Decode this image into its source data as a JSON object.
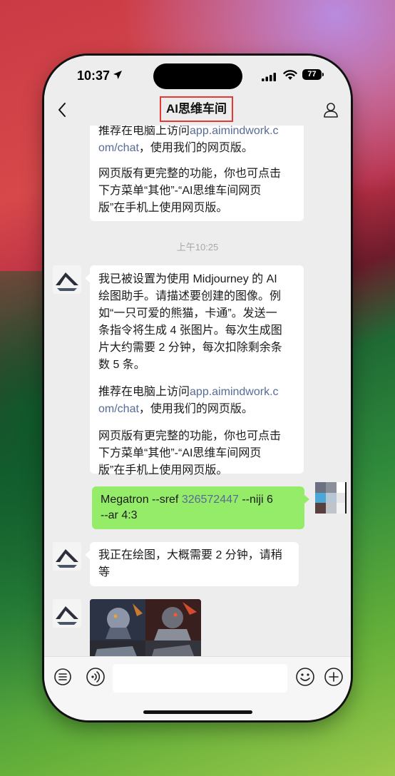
{
  "status_bar": {
    "time": "10:37",
    "battery": "77"
  },
  "nav": {
    "title": "AI思维车间"
  },
  "messages": {
    "first_partial": {
      "line1_pre": "推荐在电脑上访问",
      "line1_link": "app.aimindwork.c",
      "line2_link": "om/chat",
      "line2_post": "，使用我们的网页版。",
      "para2_line1": "网页版有更完整的功能，你也可点击",
      "para2_line2": "下方菜单“其他”-“AI思维车间网页",
      "para2_line3": "版”在手机上使用网页版。"
    },
    "timestamp": "上午10:25",
    "bot_intro": {
      "l1": "我已被设置为使用 Midjourney 的 AI",
      "l2": "绘图助手。请描述要创建的图像。例",
      "l3": "如“一只可爱的熊猫，卡通”。发送一",
      "l4": "条指令将生成 4 张图片。每次生成图",
      "l5": "片大约需要 2 分钟，每次扣除剩余条",
      "l6": "数 5 条。",
      "p2_pre": "推荐在电脑上访问",
      "p2_link1": "app.aimindwork.c",
      "p2_link2": "om/chat",
      "p2_post": "，使用我们的网页版。",
      "p3_l1": "网页版有更完整的功能，你也可点击",
      "p3_l2": "下方菜单“其他”-“AI思维车间网页",
      "p3_l3": "版”在手机上使用网页版。"
    },
    "user_msg": {
      "pre": "Megatron --sref ",
      "num": "326572447",
      "post": " --niji 6",
      "line2": "--ar 4:3"
    },
    "bot_reply": {
      "l1": "我正在绘图，大概需要 2 分钟，请稍",
      "l2": "等"
    }
  },
  "icons": {
    "back": "chevron-left-icon",
    "profile": "person-icon",
    "menu": "list-icon",
    "voice": "voice-icon",
    "emoji": "emoji-icon",
    "plus": "plus-circle-icon"
  },
  "colors": {
    "user_bubble": "#95ec69",
    "link": "#576b95",
    "chat_bg": "#ededed",
    "highlight_box": "#e53935"
  }
}
